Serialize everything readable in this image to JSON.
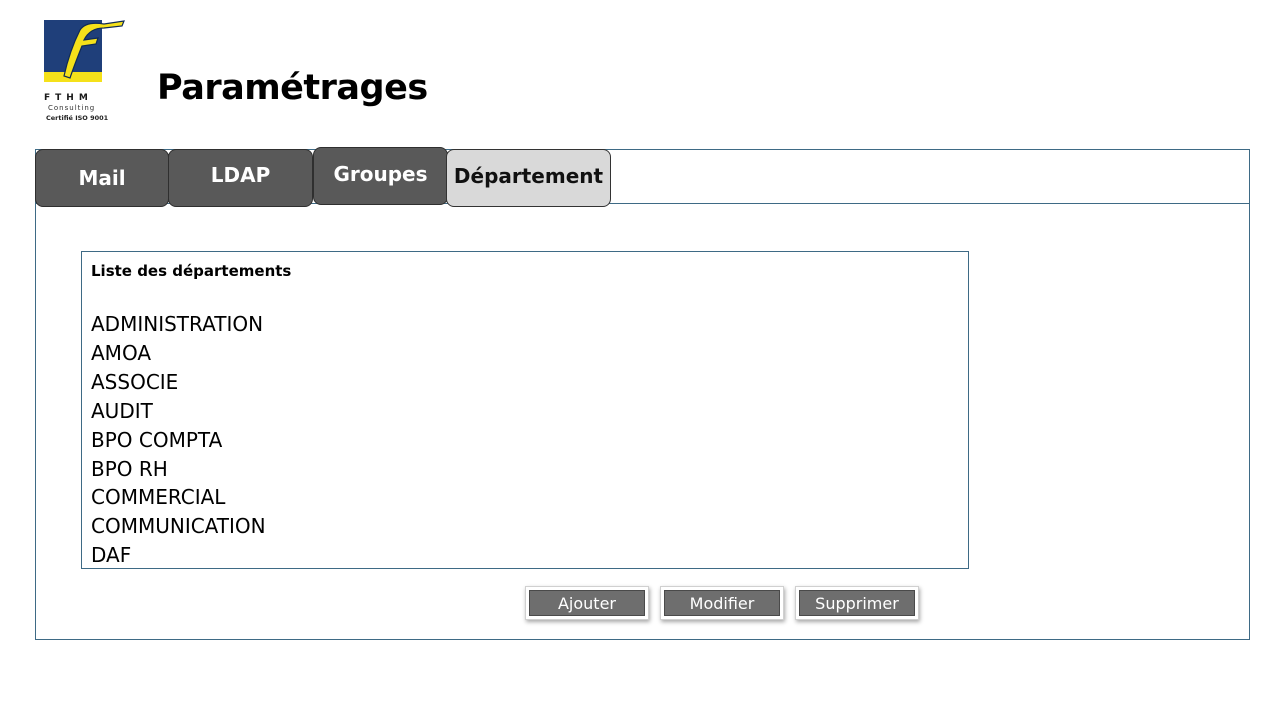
{
  "logo": {
    "letters": "FTHM",
    "subtitle": "Consulting",
    "certification": "Certifié ISO 9001",
    "colors": {
      "square": "#1f3f7a",
      "accent": "#f5e11a"
    }
  },
  "page_title": "Paramétrages",
  "tabs": [
    {
      "label": "Mail",
      "active": false
    },
    {
      "label": "LDAP",
      "active": false
    },
    {
      "label": "Groupes",
      "active": false
    },
    {
      "label": "Département",
      "active": true
    }
  ],
  "department_list": {
    "header": "Liste des départements",
    "items": [
      "ADMINISTRATION",
      "AMOA",
      "ASSOCIE",
      "AUDIT",
      "BPO COMPTA",
      "BPO RH",
      "COMMERCIAL",
      "COMMUNICATION",
      "DAF"
    ]
  },
  "actions": {
    "add_label": "Ajouter",
    "edit_label": "Modifier",
    "delete_label": "Supprimer"
  },
  "colors": {
    "tab_inactive": "#595959",
    "tab_active": "#d9d9d9",
    "border": "#3e6a85",
    "button": "#6e6e6e"
  }
}
